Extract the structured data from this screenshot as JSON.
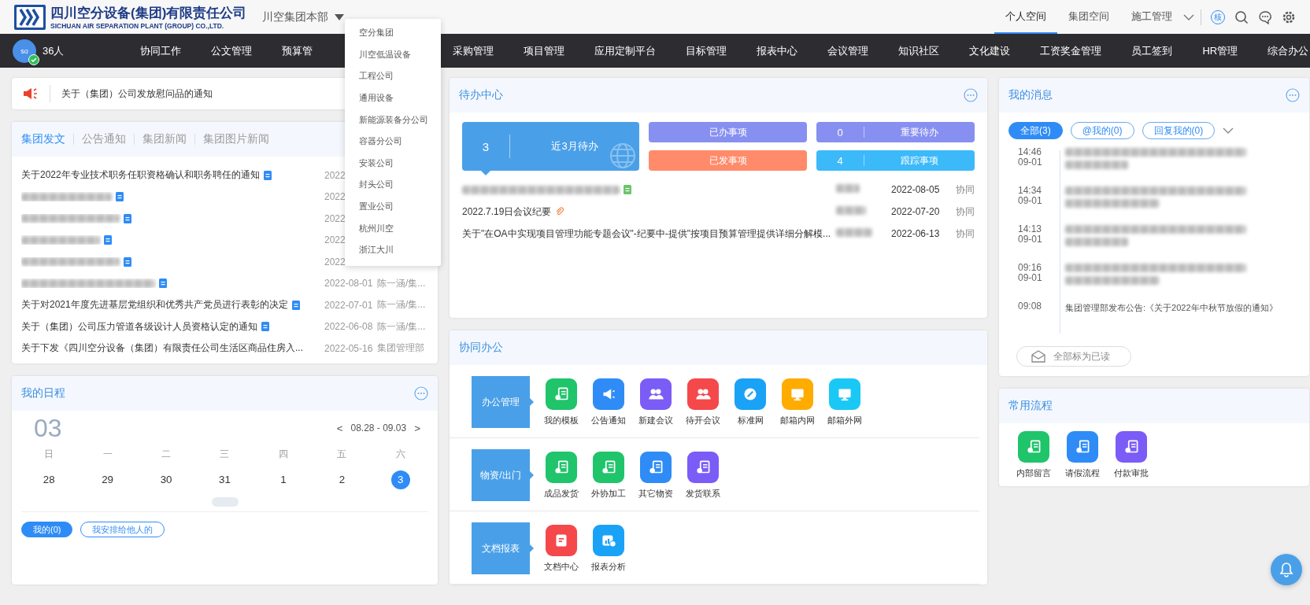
{
  "header": {
    "logo_title": "四川空分设备(集团)有限责任公司",
    "logo_subtitle": "SICHUAN AIR SEPARATION PLANT (GROUP) CO.,LTD.",
    "org_selector": "川空集团本部",
    "spaces": [
      {
        "label": "个人空间",
        "selected": true
      },
      {
        "label": "集团空间",
        "selected": false
      },
      {
        "label": "施工管理",
        "selected": false
      }
    ],
    "user_badge": "核"
  },
  "org_dropdown": {
    "items": [
      "空分集团",
      "川空低温设备",
      "工程公司",
      "通用设备",
      "新能源装备分公司",
      "容器分公司",
      "安装公司",
      "封头公司",
      "置业公司",
      "杭州川空",
      "浙江大川"
    ]
  },
  "nav": {
    "avatar_text": "so",
    "online_count": "36人",
    "items": [
      {
        "label": "协同工作"
      },
      {
        "label": "公文管理"
      },
      {
        "label": "预算管"
      },
      {
        "label": "采购管理"
      },
      {
        "label": "项目管理"
      },
      {
        "label": "应用定制平台"
      },
      {
        "label": "目标管理"
      },
      {
        "label": "报表中心"
      },
      {
        "label": "会议管理"
      },
      {
        "label": "知识社区"
      },
      {
        "label": "文化建设"
      },
      {
        "label": "工资奖金管理"
      },
      {
        "label": "员工签到"
      },
      {
        "label": "HR管理"
      },
      {
        "label": "综合办公"
      }
    ]
  },
  "notice": {
    "text": "关于（集团）公司发放慰问品的通知"
  },
  "news": {
    "tabs": [
      {
        "label": "集团发文",
        "selected": true
      },
      {
        "label": "公告通知",
        "selected": false
      },
      {
        "label": "集团新闻",
        "selected": false
      },
      {
        "label": "集团图片新闻",
        "selected": false
      }
    ],
    "rows": [
      {
        "title": "关于2022年专业技术职务任职资格确认和职务聘任的通知",
        "blurred": false,
        "attachment": true,
        "date": "2022"
      },
      {
        "blurred": true,
        "attachment": true,
        "date": "2022"
      },
      {
        "blurred": true,
        "attachment": true,
        "date": "2022"
      },
      {
        "blurred": true,
        "attachment": true,
        "date": "2022"
      },
      {
        "blurred": true,
        "attachment": true,
        "date": "2022"
      },
      {
        "blurred": true,
        "attachment": true,
        "date": "2022-08-01",
        "author": "陈一涵/集..."
      },
      {
        "title": "关于对2021年度先进基层党组织和优秀共产党员进行表彰的决定",
        "blurred": false,
        "attachment": true,
        "date": "2022-07-01",
        "author": "陈一涵/集..."
      },
      {
        "title": "关于（集团）公司压力管道各级设计人员资格认定的通知",
        "blurred": false,
        "attachment": true,
        "date": "2022-06-08",
        "author": "陈一涵/集..."
      },
      {
        "title": "关于下发《四川空分设备（集团）有限责任公司生活区商品住房入...",
        "blurred": false,
        "attachment": false,
        "date": "2022-05-16",
        "author": "集团管理部"
      }
    ]
  },
  "schedule": {
    "title": "我的日程",
    "day": "03",
    "range": "08.28 - 09.03",
    "prev": "<",
    "next": ">",
    "weekdays": [
      "日",
      "一",
      "二",
      "三",
      "四",
      "五",
      "六"
    ],
    "dates": [
      {
        "label": "28",
        "selected": false
      },
      {
        "label": "29",
        "selected": false
      },
      {
        "label": "30",
        "selected": false
      },
      {
        "label": "31",
        "selected": false
      },
      {
        "label": "1",
        "selected": false
      },
      {
        "label": "2",
        "selected": false
      },
      {
        "label": "3",
        "selected": true
      }
    ],
    "filters": [
      {
        "label": "我的(0)",
        "selected": true
      },
      {
        "label": "我安排给他人的",
        "selected": false
      }
    ]
  },
  "todo": {
    "title": "待办中心",
    "main": {
      "count": "3",
      "label": "近3月待办"
    },
    "tiles": [
      {
        "label": "已办事项",
        "color": "#8790f0"
      },
      {
        "count": "0",
        "label": "重要待办",
        "color": "#8790f0"
      },
      {
        "label": "已发事项",
        "color": "#ff8b6a"
      },
      {
        "count": "4",
        "label": "跟踪事项",
        "color": "#3cb9f9"
      }
    ],
    "rows": [
      {
        "blurred": true,
        "file_icon": true,
        "sender_blurred": true,
        "date": "2022-08-05",
        "source": "协同"
      },
      {
        "title": "2022.7.19日会议纪要",
        "blurred": false,
        "clip_icon": true,
        "sender_blurred": true,
        "date": "2022-07-20",
        "source": "协同"
      },
      {
        "title": "关于\"在OA中实现项目管理功能专题会议\"-纪要中-提供\"按项目预算管理提供详细分解模...",
        "blurred": false,
        "sender_blurred": true,
        "date": "2022-06-13",
        "source": "协同"
      }
    ]
  },
  "collab": {
    "title": "协同办公",
    "sections": [
      {
        "label": "办公管理",
        "apps": [
          {
            "label": "我的模板",
            "kind": "doc",
            "color": "#1fc46b"
          },
          {
            "label": "公告通知",
            "kind": "megaphone",
            "color": "#2f8cf6"
          },
          {
            "label": "新建会议",
            "kind": "people",
            "color": "#7b5cf6"
          },
          {
            "label": "待开会议",
            "kind": "people",
            "color": "#f5484b"
          },
          {
            "label": "标准网",
            "kind": "link",
            "color": "#1aa2f6"
          },
          {
            "label": "邮箱内网",
            "kind": "monitor",
            "color": "#ffab00"
          },
          {
            "label": "邮箱外网",
            "kind": "monitor",
            "color": "#1ac8f6"
          }
        ]
      },
      {
        "label": "物资/出门",
        "apps": [
          {
            "label": "成品发货",
            "kind": "doc",
            "color": "#1fc46b"
          },
          {
            "label": "外协加工",
            "kind": "doc",
            "color": "#1fc46b"
          },
          {
            "label": "其它物资",
            "kind": "doc",
            "color": "#2f8cf6"
          },
          {
            "label": "发货联系",
            "kind": "doc",
            "color": "#7b5cf6"
          }
        ]
      },
      {
        "label": "文档报表",
        "apps": [
          {
            "label": "文档中心",
            "kind": "file",
            "color": "#f5484b"
          },
          {
            "label": "报表分析",
            "kind": "chart",
            "color": "#1aa2f6"
          }
        ]
      }
    ]
  },
  "messages": {
    "title": "我的消息",
    "tabs": [
      {
        "label": "全部(3)",
        "selected": true
      },
      {
        "label": "@我的(0)",
        "selected": false
      },
      {
        "label": "回复我的(0)",
        "selected": false
      }
    ],
    "items": [
      {
        "time": "14:46",
        "date": "09-01",
        "blurred": true
      },
      {
        "time": "14:34",
        "date": "09-01",
        "blurred": true
      },
      {
        "time": "14:13",
        "date": "09-01",
        "blurred": true
      },
      {
        "time": "09:16",
        "date": "09-01",
        "blurred": true
      },
      {
        "time": "09:08",
        "text": "集团管理部发布公告:《关于2022年中秋节放假的通知》",
        "blurred": false
      }
    ],
    "mark_all_read": "全部标为已读"
  },
  "flows": {
    "title": "常用流程",
    "apps": [
      {
        "label": "内部留言",
        "kind": "doc",
        "color": "#1fc46b"
      },
      {
        "label": "请假流程",
        "kind": "doc",
        "color": "#2f8cf6"
      },
      {
        "label": "付款审批",
        "kind": "doc",
        "color": "#7b5cf6"
      }
    ]
  }
}
